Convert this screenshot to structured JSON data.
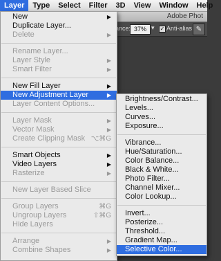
{
  "menubar": {
    "items": [
      "Layer",
      "Type",
      "Select",
      "Filter",
      "3D",
      "View",
      "Window",
      "Help"
    ]
  },
  "app": {
    "title": "Adobe Phot"
  },
  "options_bar": {
    "tolerance_label": "rance:",
    "tolerance_value": "37%",
    "anti_alias_label": "Anti-alias"
  },
  "layer_menu": {
    "new": "New",
    "duplicate_layer": "Duplicate Layer...",
    "delete": "Delete",
    "rename_layer": "Rename Layer...",
    "layer_style": "Layer Style",
    "smart_filter": "Smart Filter",
    "new_fill_layer": "New Fill Layer",
    "new_adjustment_layer": "New Adjustment Layer",
    "layer_content_options": "Layer Content Options...",
    "layer_mask": "Layer Mask",
    "vector_mask": "Vector Mask",
    "create_clipping_mask": "Create Clipping Mask",
    "create_clipping_mask_shortcut": "⌥⌘G",
    "smart_objects": "Smart Objects",
    "video_layers": "Video Layers",
    "rasterize": "Rasterize",
    "new_layer_based_slice": "New Layer Based Slice",
    "group_layers": "Group Layers",
    "group_layers_shortcut": "⌘G",
    "ungroup_layers": "Ungroup Layers",
    "ungroup_layers_shortcut": "⇧⌘G",
    "hide_layers": "Hide Layers",
    "arrange": "Arrange",
    "combine_shapes": "Combine Shapes"
  },
  "adjustment_submenu": {
    "brightness_contrast": "Brightness/Contrast...",
    "levels": "Levels...",
    "curves": "Curves...",
    "exposure": "Exposure...",
    "vibrance": "Vibrance...",
    "hue_saturation": "Hue/Saturation...",
    "color_balance": "Color Balance...",
    "black_white": "Black & White...",
    "photo_filter": "Photo Filter...",
    "channel_mixer": "Channel Mixer...",
    "color_lookup": "Color Lookup...",
    "invert": "Invert...",
    "posterize": "Posterize...",
    "threshold": "Threshold...",
    "gradient_map": "Gradient Map...",
    "selective_color": "Selective Color..."
  },
  "colors": {
    "highlight": "#2f6de0",
    "menu_bg": "#eaeaea",
    "disabled_text": "#9a9a9a"
  }
}
